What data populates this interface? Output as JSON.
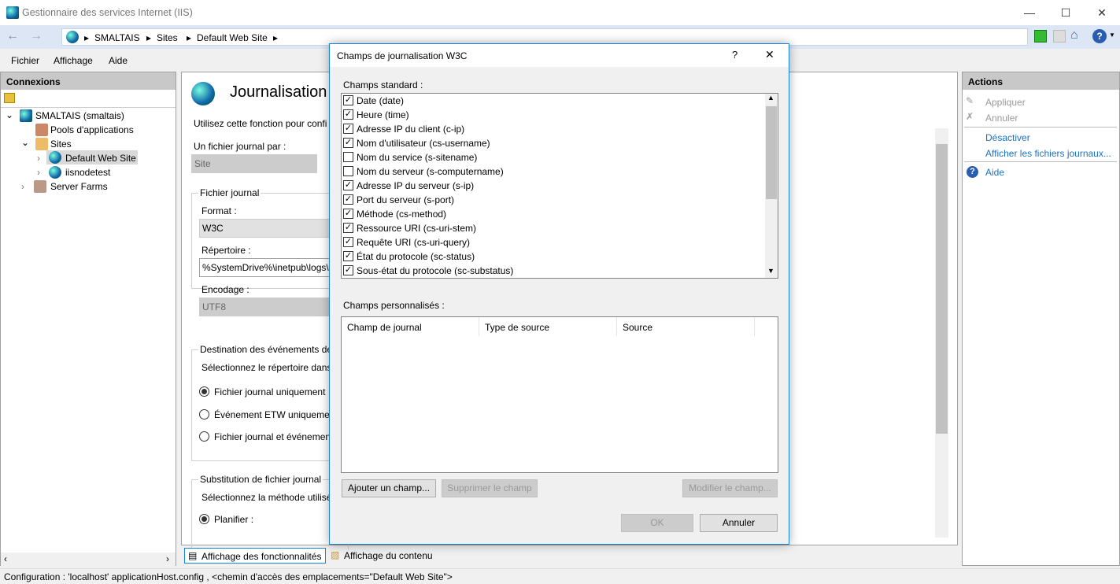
{
  "window": {
    "title": "Gestionnaire des services Internet (IIS)",
    "minimize": "—",
    "maximize": "☐",
    "close": "✕"
  },
  "breadcrumb": [
    "SMALTAIS",
    "Sites",
    "Default Web Site"
  ],
  "menu": [
    "Fichier",
    "Affichage",
    "Aide"
  ],
  "connections": {
    "title": "Connexions",
    "tree": [
      {
        "label": "SMALTAIS (smaltais)"
      },
      {
        "label": "Pools d'applications"
      },
      {
        "label": "Sites"
      },
      {
        "label": "Default Web Site"
      },
      {
        "label": "iisnodetest"
      },
      {
        "label": "Server Farms"
      }
    ]
  },
  "main": {
    "title": "Journalisation",
    "description": "Utilisez cette fonction pour confi",
    "log_per_label": "Un fichier journal par :",
    "log_per_value": "Site",
    "logfile_group": "Fichier journal",
    "format_label": "Format :",
    "format_value": "W3C",
    "directory_label": "Répertoire :",
    "directory_value": "%SystemDrive%\\inetpub\\logs\\",
    "encoding_label": "Encodage :",
    "encoding_value": "UTF8",
    "dest_group": "Destination des événements de j",
    "dest_desc": "Sélectionnez le répertoire dans",
    "dest_options": [
      "Fichier journal uniquement",
      "Événement ETW uniquemen",
      "Fichier journal et événemen"
    ],
    "rollover_group": "Substitution de fichier journal",
    "rollover_desc": "Sélectionnez la méthode utilisé",
    "schedule_label": "Planifier :"
  },
  "bottom_tabs": {
    "features": "Affichage des fonctionnalités",
    "content": "Affichage du contenu"
  },
  "actions": {
    "title": "Actions",
    "apply": "Appliquer",
    "cancel": "Annuler",
    "disable": "Désactiver",
    "view_logs": "Afficher les fichiers journaux...",
    "help": "Aide"
  },
  "status": "Configuration : 'localhost' applicationHost.config , <chemin d'accès des emplacements=\"Default Web Site\">",
  "dialog": {
    "title": "Champs de journalisation W3C",
    "help": "?",
    "close": "✕",
    "standard_label": "Champs standard :",
    "fields": [
      {
        "label": "Date (date)",
        "checked": true
      },
      {
        "label": "Heure (time)",
        "checked": true
      },
      {
        "label": "Adresse IP du client (c-ip)",
        "checked": true
      },
      {
        "label": "Nom d'utilisateur (cs-username)",
        "checked": true
      },
      {
        "label": "Nom du service (s-sitename)",
        "checked": false
      },
      {
        "label": "Nom du serveur (s-computername)",
        "checked": false
      },
      {
        "label": "Adresse IP du serveur (s-ip)",
        "checked": true
      },
      {
        "label": "Port du serveur (s-port)",
        "checked": true
      },
      {
        "label": "Méthode (cs-method)",
        "checked": true
      },
      {
        "label": "Ressource URI (cs-uri-stem)",
        "checked": true
      },
      {
        "label": "Requête URI (cs-uri-query)",
        "checked": true
      },
      {
        "label": "État du protocole (sc-status)",
        "checked": true
      },
      {
        "label": "Sous-état du protocole (sc-substatus)",
        "checked": true
      }
    ],
    "custom_label": "Champs personnalisés :",
    "columns": [
      "Champ de journal",
      "Type de source",
      "Source"
    ],
    "add": "Ajouter un champ...",
    "remove": "Supprimer le champ",
    "edit": "Modifier le champ...",
    "ok": "OK",
    "cancel": "Annuler"
  }
}
